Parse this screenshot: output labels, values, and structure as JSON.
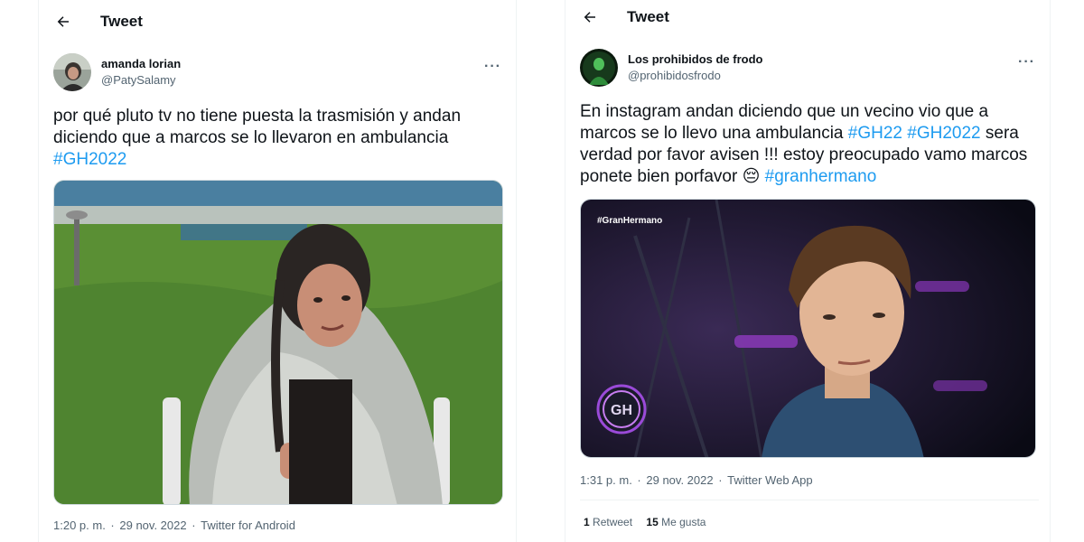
{
  "left_tweet": {
    "header_title": "Tweet",
    "author_name": "amanda lorian",
    "author_handle": "@PatySalamy",
    "more": "···",
    "text_before": "por qué pluto tv no tiene puesta la trasmisión y andan diciendo que a marcos se lo llevaron en ambulancia ",
    "hashtag": "#GH2022",
    "time": "1:20 p. m.",
    "date": "29 nov. 2022",
    "source": "Twitter for Android"
  },
  "right_tweet": {
    "header_title": "Tweet",
    "author_name": "Los prohibidos de frodo",
    "author_handle": "@prohibidosfrodo",
    "more": "···",
    "text_part1": "En instagram andan diciendo que un vecino vio que a marcos se lo llevo una ambulancia ",
    "hashtag1": "#GH22",
    "hashtag2": "#GH2022",
    "text_part2": " sera verdad por favor avisen !!! estoy preocupado vamo marcos ponete bien porfavor ",
    "emoji": "😔",
    "hashtag3": "#granhermano",
    "media_overlay": "#GranHermano",
    "logo_text": "GH",
    "time": "1:31 p. m.",
    "date": "29 nov. 2022",
    "source": "Twitter Web App",
    "retweets_count": "1",
    "retweets_label": "Retweet",
    "likes_count": "15",
    "likes_label": "Me gusta"
  },
  "colors": {
    "link": "#1d9bf0",
    "secondary": "#536471",
    "text": "#0f1419"
  }
}
